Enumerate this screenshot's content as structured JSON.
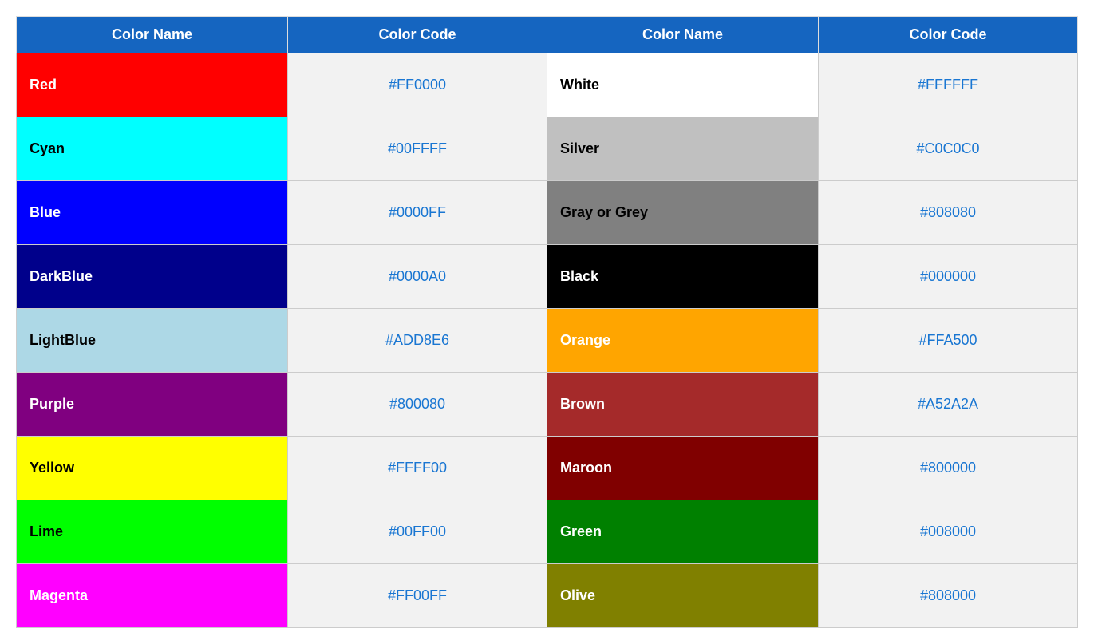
{
  "table": {
    "headers": [
      "Color Name",
      "Color Code",
      "Color Name",
      "Color Code"
    ],
    "rows": [
      {
        "left": {
          "name": "Red",
          "color": "#FF0000",
          "text_color": "#ffffff",
          "code": "#FF0000"
        },
        "right": {
          "name": "White",
          "color": "#ffffff",
          "text_color": "#000000",
          "code": "#FFFFFF"
        }
      },
      {
        "left": {
          "name": "Cyan",
          "color": "#00FFFF",
          "text_color": "#000000",
          "code": "#00FFFF"
        },
        "right": {
          "name": "Silver",
          "color": "#C0C0C0",
          "text_color": "#000000",
          "code": "#C0C0C0"
        }
      },
      {
        "left": {
          "name": "Blue",
          "color": "#0000FF",
          "text_color": "#ffffff",
          "code": "#0000FF"
        },
        "right": {
          "name": "Gray or Grey",
          "color": "#808080",
          "text_color": "#000000",
          "code": "#808080"
        }
      },
      {
        "left": {
          "name": "DarkBlue",
          "color": "#00008B",
          "text_color": "#ffffff",
          "code": "#0000A0"
        },
        "right": {
          "name": "Black",
          "color": "#000000",
          "text_color": "#ffffff",
          "code": "#000000"
        }
      },
      {
        "left": {
          "name": "LightBlue",
          "color": "#ADD8E6",
          "text_color": "#000000",
          "code": "#ADD8E6"
        },
        "right": {
          "name": "Orange",
          "color": "#FFA500",
          "text_color": "#ffffff",
          "code": "#FFA500"
        }
      },
      {
        "left": {
          "name": "Purple",
          "color": "#800080",
          "text_color": "#ffffff",
          "code": "#800080"
        },
        "right": {
          "name": "Brown",
          "color": "#A52A2A",
          "text_color": "#ffffff",
          "code": "#A52A2A"
        }
      },
      {
        "left": {
          "name": "Yellow",
          "color": "#FFFF00",
          "text_color": "#000000",
          "code": "#FFFF00"
        },
        "right": {
          "name": "Maroon",
          "color": "#800000",
          "text_color": "#ffffff",
          "code": "#800000"
        }
      },
      {
        "left": {
          "name": "Lime",
          "color": "#00FF00",
          "text_color": "#000000",
          "code": "#00FF00"
        },
        "right": {
          "name": "Green",
          "color": "#008000",
          "text_color": "#ffffff",
          "code": "#008000"
        }
      },
      {
        "left": {
          "name": "Magenta",
          "color": "#FF00FF",
          "text_color": "#ffffff",
          "code": "#FF00FF"
        },
        "right": {
          "name": "Olive",
          "color": "#808000",
          "text_color": "#ffffff",
          "code": "#808000"
        }
      }
    ]
  }
}
